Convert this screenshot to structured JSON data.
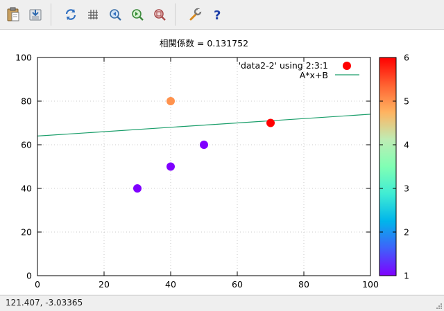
{
  "toolbar": {
    "buttons": [
      {
        "name": "copy-to-clipboard-icon"
      },
      {
        "name": "export-icon"
      },
      {
        "name": "replot-icon"
      },
      {
        "name": "grid-icon"
      },
      {
        "name": "zoom-previous-icon"
      },
      {
        "name": "zoom-next-icon"
      },
      {
        "name": "autoscale-icon"
      },
      {
        "name": "settings-wrench-icon"
      },
      {
        "name": "help-icon"
      }
    ]
  },
  "status": {
    "coordinates": "121.407, -3.03365"
  },
  "chart_data": {
    "type": "scatter",
    "title": "相関係数 = 0.131752",
    "xlim": [
      0,
      100
    ],
    "ylim": [
      0,
      100
    ],
    "x_ticks": [
      "0",
      "20",
      "40",
      "60",
      "80",
      "100"
    ],
    "y_ticks": [
      "0",
      "20",
      "40",
      "60",
      "80",
      "100"
    ],
    "grid": true,
    "legend_position": "top-right",
    "series": [
      {
        "name": "'data2-2' using 2:3:1",
        "kind": "points",
        "points": [
          {
            "x": 30,
            "y": 40,
            "c": 1
          },
          {
            "x": 40,
            "y": 50,
            "c": 1
          },
          {
            "x": 50,
            "y": 60,
            "c": 1
          },
          {
            "x": 40,
            "y": 80,
            "c": 5
          },
          {
            "x": 70,
            "y": 70,
            "c": 6
          }
        ]
      },
      {
        "name": "A*x+B",
        "kind": "line",
        "color": "#1a9e6a",
        "x": [
          0,
          100
        ],
        "y": [
          64,
          74
        ]
      }
    ],
    "colorbar": {
      "range": [
        1,
        6
      ],
      "ticks": [
        "1",
        "2",
        "3",
        "4",
        "5",
        "6"
      ],
      "palette": [
        "#7f00ff",
        "#3f61fa",
        "#00b5eb",
        "#40ecd4",
        "#80ffb4",
        "#bfecb4",
        "#ffb360",
        "#ff6131",
        "#ff0000"
      ]
    }
  }
}
